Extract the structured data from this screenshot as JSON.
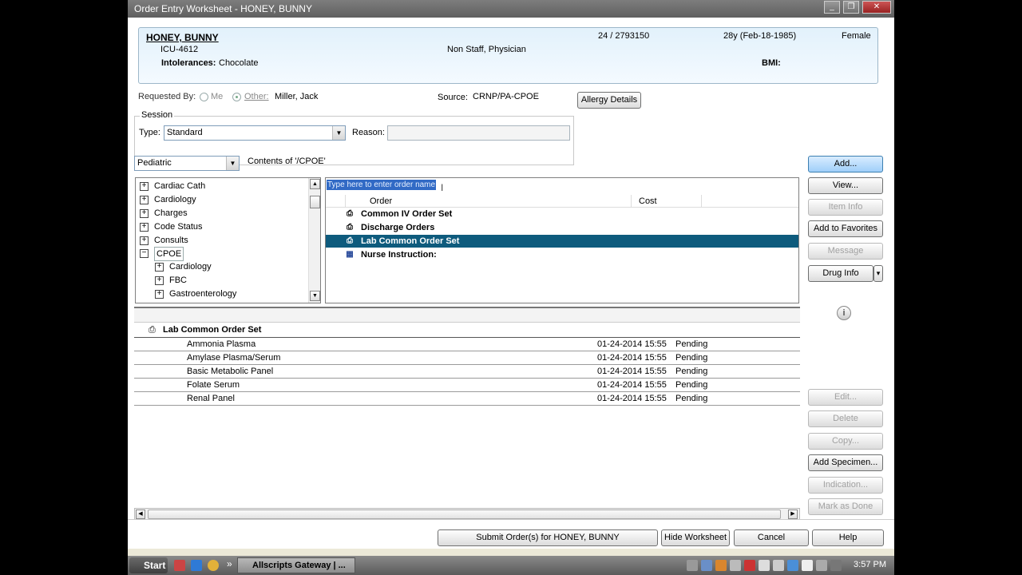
{
  "window": {
    "title": "Order Entry Worksheet - HONEY, BUNNY",
    "min": "_",
    "restore": "❐",
    "close": "✕"
  },
  "patient": {
    "name": "HONEY, BUNNY",
    "location": "ICU-4612",
    "intolerances_label": "Intolerances:",
    "intolerances_value": "Chocolate",
    "encounter": "24 / 2793150",
    "staff": "Non Staff, Physician",
    "age_dob": "28y (Feb-18-1985)",
    "sex": "Female",
    "bmi_label": "BMI:"
  },
  "request": {
    "requested_by_label": "Requested By:",
    "me_label": "Me",
    "other_label": "Other:",
    "other_value": "Miller, Jack",
    "source_label": "Source:",
    "source_value": "CRNP/PA-CPOE",
    "allergy_button": "Allergy Details"
  },
  "session": {
    "title": "Session",
    "type_label": "Type:",
    "type_value": "Standard",
    "reason_label": "Reason:",
    "reason_value": ""
  },
  "catalog": {
    "dropdown_value": "Pediatric",
    "contents_label": "Contents of '/CPOE'",
    "tree": [
      {
        "label": "Cardiac Cath",
        "expander": "+"
      },
      {
        "label": "Cardiology",
        "expander": "+"
      },
      {
        "label": "Charges",
        "expander": "+"
      },
      {
        "label": "Code Status",
        "expander": "+"
      },
      {
        "label": "Consults",
        "expander": "+"
      },
      {
        "label": "CPOE",
        "expander": "−"
      },
      {
        "label": "Cardiology",
        "expander": "+"
      },
      {
        "label": "FBC",
        "expander": "+"
      },
      {
        "label": "Gastroenterology",
        "expander": "+"
      }
    ]
  },
  "orders": {
    "search_placeholder": "Type here to enter order name",
    "col_order": "Order",
    "col_cost": "Cost",
    "rows": [
      {
        "label": "Common IV Order Set",
        "icon": "⎙"
      },
      {
        "label": "Discharge Orders",
        "icon": "⎙"
      },
      {
        "label": "Lab Common Order Set",
        "icon": "⎙"
      },
      {
        "label": "Nurse Instruction:",
        "icon": "▦"
      }
    ]
  },
  "detail": {
    "header": "Lab Common Order Set",
    "items": [
      {
        "name": "Ammonia Plasma",
        "date": "01-24-2014 15:55",
        "status": "Pending"
      },
      {
        "name": "Amylase Plasma/Serum",
        "date": "01-24-2014 15:55",
        "status": "Pending"
      },
      {
        "name": "Basic Metabolic Panel",
        "date": "01-24-2014 15:55",
        "status": "Pending"
      },
      {
        "name": "Folate Serum",
        "date": "01-24-2014 15:55",
        "status": "Pending"
      },
      {
        "name": "Renal Panel",
        "date": "01-24-2014 15:55",
        "status": "Pending"
      }
    ]
  },
  "side_buttons": {
    "add": "Add...",
    "view": "View...",
    "item_info": "Item Info",
    "add_favorites": "Add to Favorites",
    "message": "Message",
    "drug_info": "Drug Info",
    "drug_arrow": "▾",
    "info": "i",
    "edit": "Edit...",
    "delete": "Delete",
    "copy": "Copy...",
    "add_specimen": "Add Specimen...",
    "indication": "Indication...",
    "mark_done": "Mark as Done"
  },
  "footer": {
    "submit": "Submit Order(s) for HONEY, BUNNY",
    "hide": "Hide Worksheet",
    "cancel": "Cancel",
    "help": "Help"
  },
  "taskbar": {
    "start": "Start",
    "chevron": "»",
    "task": "Allscripts Gateway | ...",
    "clock": "3:57 PM"
  },
  "colors": {
    "selected_row": "#0e5b7d",
    "patient_banner": "#e2f1fb",
    "primary_button": "#9fcff9"
  }
}
